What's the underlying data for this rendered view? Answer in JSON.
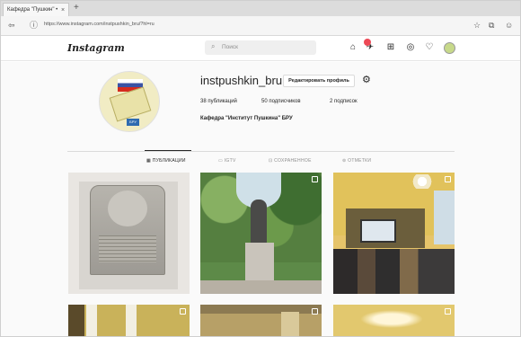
{
  "browser": {
    "tab_title": "Кафедра \"Пушкин\" •",
    "tab_close": "×",
    "tab_new": "+",
    "url": "https://www.instagram.com/instpushkin_bru/?hl=ru",
    "nav_back": "⇦",
    "nav_lock": "ⓘ"
  },
  "header": {
    "logo": "Instagram",
    "search_placeholder": "Поиск",
    "search_icon": "⌕"
  },
  "profile": {
    "username": "instpushkin_bru",
    "edit_button": "Редактировать профиль",
    "settings_icon": "⚙",
    "posts": "38 публикаций",
    "followers": "50 подписчиков",
    "following": "2 подписок",
    "full_name": "Кафедра \"Институт Пушкина\" БРУ",
    "avatar_caption": "БРУ"
  },
  "tabs": [
    {
      "label": "▦ ПУБЛИКАЦИИ",
      "active": true
    },
    {
      "label": "▭ IGTV",
      "active": false
    },
    {
      "label": "⊡ СОХРАНЕННОЕ",
      "active": false
    },
    {
      "label": "⊚ ОТМЕТКИ",
      "active": false
    }
  ],
  "colors": {
    "accent": "#262626",
    "badge": "#ed4956",
    "border": "#dbdbdb"
  }
}
